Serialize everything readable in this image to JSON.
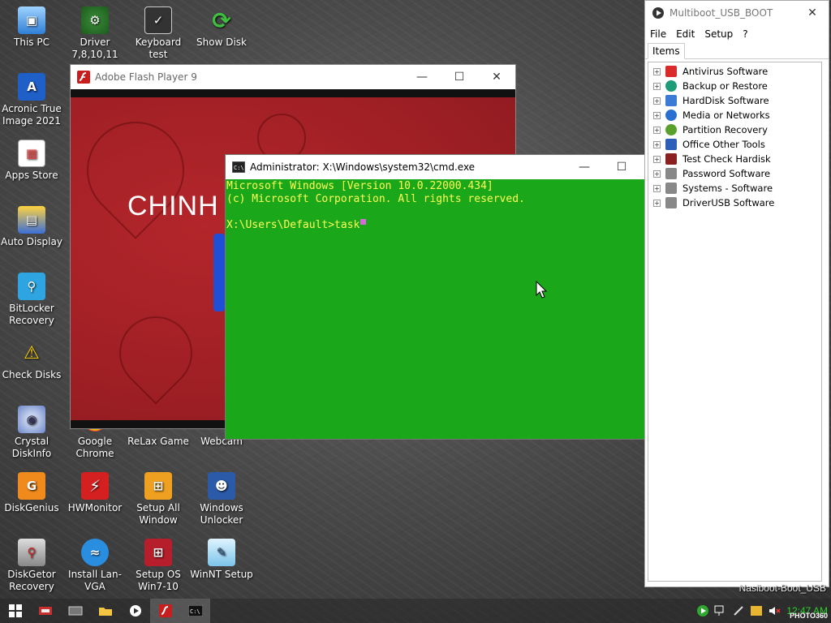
{
  "desktop_icons": [
    {
      "label": "This PC",
      "icon": "computer-icon"
    },
    {
      "label": "Driver 7,8,10,11",
      "icon": "driver-icon"
    },
    {
      "label": "Keyboard test",
      "icon": "keyboard-test-icon"
    },
    {
      "label": "Show Disk",
      "icon": "refresh-disk-icon"
    },
    {
      "label": "Acronic True Image 2021",
      "icon": "acronis-icon"
    },
    {
      "label": "Apps Store",
      "icon": "store-bag-icon"
    },
    {
      "label": "Auto Display",
      "icon": "display-icon"
    },
    {
      "label": "BitLocker Recovery",
      "icon": "magnifier-icon"
    },
    {
      "label": "Check Disks",
      "icon": "disk-warning-icon"
    },
    {
      "label": "Crystal DiskInfo",
      "icon": "crystal-disk-icon"
    },
    {
      "label": "Google Chrome",
      "icon": "chrome-icon"
    },
    {
      "label": "ReLax Game",
      "icon": "game-icon"
    },
    {
      "label": "Webcam",
      "icon": "webcam-icon"
    },
    {
      "label": "DiskGenius",
      "icon": "diskgenius-icon"
    },
    {
      "label": "HWMonitor",
      "icon": "hwmonitor-icon"
    },
    {
      "label": "Setup All Window",
      "icon": "windows-setup-icon"
    },
    {
      "label": "Windows Unlocker",
      "icon": "users-icon"
    },
    {
      "label": "DiskGetor Recovery",
      "icon": "diskgetor-icon"
    },
    {
      "label": "Install Lan-VGA",
      "icon": "wifi-icon"
    },
    {
      "label": "Setup OS Win7-10",
      "icon": "windows-81-icon"
    },
    {
      "label": "WinNT Setup",
      "icon": "winnt-setup-icon"
    }
  ],
  "flash_window": {
    "title": "Adobe Flash Player 9",
    "content_text": "CHINH"
  },
  "cmd_window": {
    "title": "Administrator: X:\\Windows\\system32\\cmd.exe",
    "lines": [
      "Microsoft Windows [Version 10.0.22000.434]",
      "(c) Microsoft Corporation. All rights reserved.",
      "",
      "X:\\Users\\Default>task"
    ],
    "bg_color": "#1aa81a",
    "text_color": "#ffff55"
  },
  "multiboot_window": {
    "title": "Multiboot_USB_BOOT",
    "menu": [
      "File",
      "Edit",
      "Setup",
      "?"
    ],
    "tab": "Items",
    "tree_items": [
      {
        "label": "Antivirus Software",
        "color": "#d92b2b"
      },
      {
        "label": "Backup or Restore",
        "color": "#1e9c7a"
      },
      {
        "label": "HardDisk Software",
        "color": "#3a7bd5"
      },
      {
        "label": "Media or Networks",
        "color": "#2a6fd0"
      },
      {
        "label": "Partition Recovery",
        "color": "#5aa02c"
      },
      {
        "label": "Office Other Tools",
        "color": "#2b5fb8"
      },
      {
        "label": "Test Check Hardisk",
        "color": "#8a2020"
      },
      {
        "label": "Password Software",
        "color": "#888888"
      },
      {
        "label": "Systems - Software",
        "color": "#888888"
      },
      {
        "label": "DriverUSB Software",
        "color": "#888888"
      }
    ]
  },
  "taskbar": {
    "clock": "12:47 AM",
    "buttons": [
      "start-icon",
      "network-tool-icon",
      "keyboard-icon",
      "folder-icon",
      "media-play-icon",
      "flash-icon",
      "cmd-icon"
    ]
  },
  "watermark": "Nasiboot-Boot_USB",
  "photo_mark": "PHOTO360"
}
